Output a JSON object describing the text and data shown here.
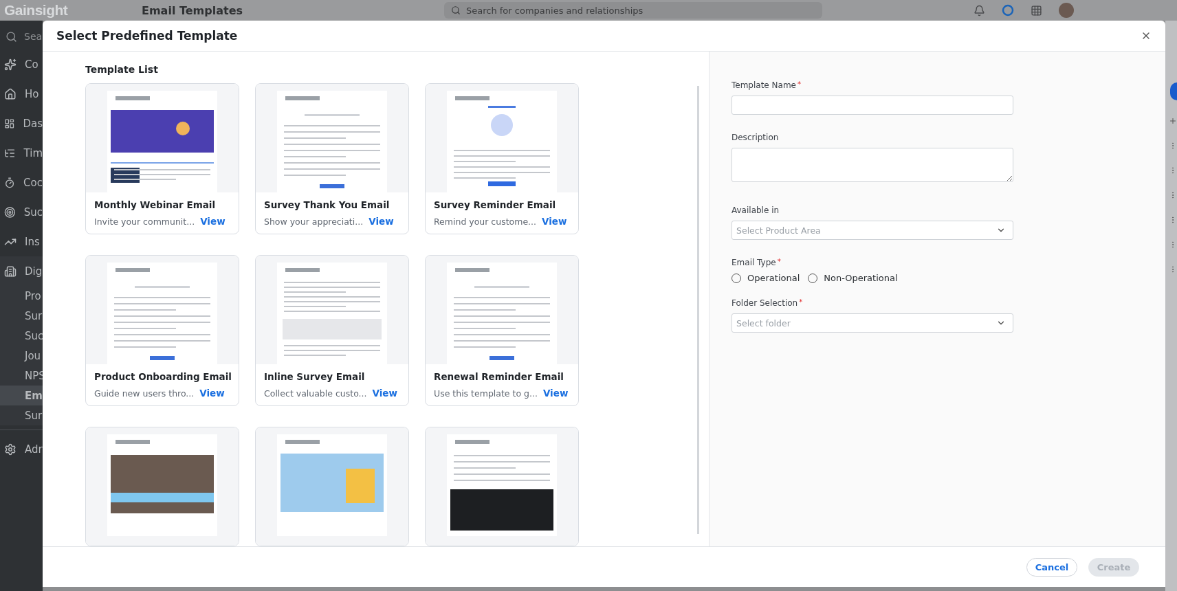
{
  "app": {
    "logo": "Gainsight",
    "page_title": "Email Templates",
    "search": {
      "placeholder": "Search for companies and relationships"
    }
  },
  "sidebar": {
    "search": {
      "placeholder": "Sea"
    },
    "items": [
      {
        "label": "Co",
        "selected": false
      },
      {
        "label": "Ho",
        "selected": false
      },
      {
        "label": "Das",
        "selected": false
      },
      {
        "label": "Tim",
        "selected": false
      },
      {
        "label": "Coc",
        "selected": false
      },
      {
        "label": "Suc",
        "selected": false
      },
      {
        "label": "Ins",
        "selected": false
      },
      {
        "label": "Dig",
        "selected": false,
        "children": [
          {
            "label": "Pro",
            "selected": false
          },
          {
            "label": "Sur",
            "selected": false
          },
          {
            "label": "Suc",
            "selected": false
          },
          {
            "label": "Jou",
            "selected": false
          },
          {
            "label": "NPS",
            "selected": false
          },
          {
            "label": "Em",
            "selected": true
          },
          {
            "label": "Sur",
            "selected": false
          }
        ]
      },
      {
        "label": "Adr",
        "selected": false
      }
    ]
  },
  "dialog": {
    "title": "Select Predefined Template",
    "list_title": "Template List",
    "templates": [
      {
        "kind": "banner",
        "title": "Monthly Webinar Email",
        "description": "Invite your communit...",
        "link": "View"
      },
      {
        "kind": "letter",
        "title": "Survey Thank You Email",
        "description": "Show your appreciati...",
        "link": "View"
      },
      {
        "kind": "illustration",
        "title": "Survey Reminder Email",
        "description": "Remind your custome...",
        "link": "View"
      },
      {
        "kind": "letter",
        "title": "Product Onboarding Email",
        "description": "Guide new users thro...",
        "link": "View"
      },
      {
        "kind": "form",
        "title": "Inline Survey Email",
        "description": "Collect valuable custo...",
        "link": "View"
      },
      {
        "kind": "letter",
        "title": "Renewal Reminder Email",
        "description": "Use this template to g...",
        "link": "View"
      },
      {
        "kind": "photo"
      },
      {
        "kind": "newsletter"
      },
      {
        "kind": "video"
      }
    ],
    "form": {
      "fields": [
        {
          "kind": "input",
          "label": "Template Name",
          "required_mark": "*"
        },
        {
          "kind": "textarea",
          "label": "Description"
        },
        {
          "kind": "select",
          "label": "Available in",
          "placeholder": "Select Product Area"
        },
        {
          "kind": "radio",
          "label": "Email Type",
          "required_mark": "*",
          "options": [
            {
              "label": "Operational",
              "selected": false
            },
            {
              "label": "Non-Operational",
              "selected": false
            }
          ]
        },
        {
          "kind": "select",
          "label": "Folder Selection",
          "required_mark": "*",
          "placeholder": "Select folder"
        }
      ]
    },
    "buttons": [
      {
        "label": "Cancel",
        "disabled": false
      },
      {
        "label": "Create",
        "disabled": true
      }
    ]
  }
}
